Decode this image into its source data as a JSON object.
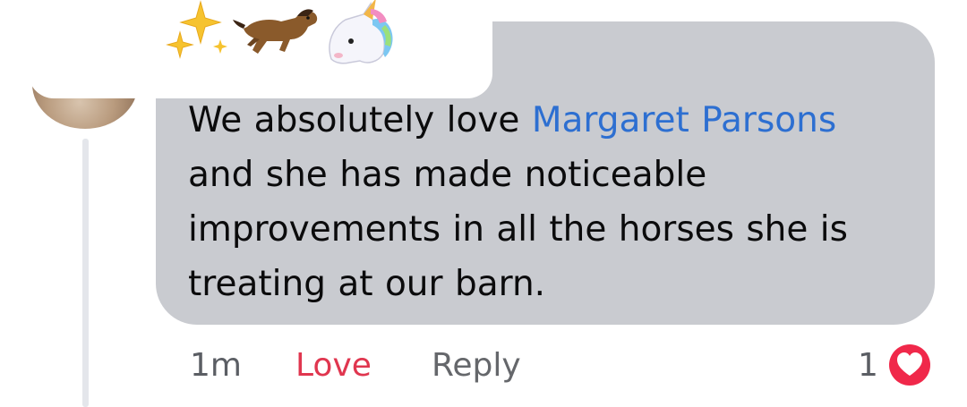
{
  "comment": {
    "text_parts": {
      "part1": "We absolutely love ",
      "mention": "Margaret Parsons",
      "part2": " and she has made noticeable improvements in all the horses she is treating at our barn."
    },
    "header_emojis": [
      "sparkles-icon",
      "horse-icon",
      "unicorn-icon"
    ]
  },
  "actions": {
    "time": "1m",
    "love": "Love",
    "reply": "Reply"
  },
  "reactions": {
    "count": "1",
    "type": "love"
  },
  "colors": {
    "bubble": "#c9cbd0",
    "mention": "#2d6fd1",
    "love": "#e0364f",
    "muted": "#65676b"
  }
}
